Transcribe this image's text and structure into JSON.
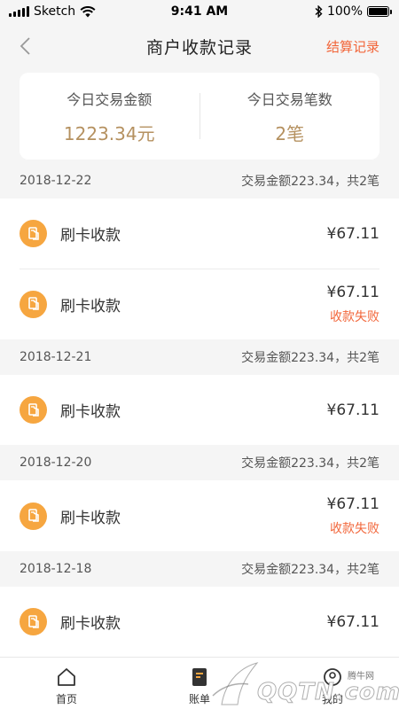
{
  "status_bar": {
    "carrier": "Sketch",
    "time": "9:41 AM",
    "battery": "100%"
  },
  "nav": {
    "title": "商户收款记录",
    "action": "结算记录"
  },
  "summary": {
    "amount_label": "今日交易金额",
    "amount_value": "1223.34元",
    "count_label": "今日交易笔数",
    "count_value": "2笔"
  },
  "groups": [
    {
      "date": "2018-12-22",
      "total": "交易金额223.34，共2笔",
      "items": [
        {
          "name": "刷卡收款",
          "amount": "¥67.11",
          "status": ""
        },
        {
          "name": "刷卡收款",
          "amount": "¥67.11",
          "status": "收款失败"
        }
      ]
    },
    {
      "date": "2018-12-21",
      "total": "交易金额223.34，共2笔",
      "items": [
        {
          "name": "刷卡收款",
          "amount": "¥67.11",
          "status": ""
        }
      ]
    },
    {
      "date": "2018-12-20",
      "total": "交易金额223.34，共2笔",
      "items": [
        {
          "name": "刷卡收款",
          "amount": "¥67.11",
          "status": "收款失败"
        }
      ]
    },
    {
      "date": "2018-12-18",
      "total": "交易金额223.34，共2笔",
      "items": [
        {
          "name": "刷卡收款",
          "amount": "¥67.11",
          "status": ""
        }
      ]
    }
  ],
  "tabs": [
    {
      "label": "首页",
      "icon": "home-icon"
    },
    {
      "label": "账单",
      "icon": "bill-icon"
    },
    {
      "label": "我的",
      "icon": "profile-icon"
    }
  ],
  "watermark": {
    "main": "QQTN.com",
    "small": "腾牛网"
  },
  "colors": {
    "accent": "#f2663a",
    "gold": "#b59160",
    "icon_orange": "#f6a640",
    "background": "#f5f5f5"
  }
}
